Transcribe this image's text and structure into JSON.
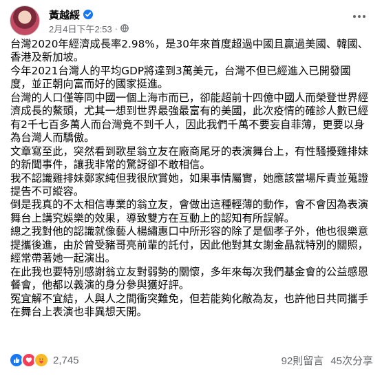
{
  "post": {
    "author": "黃越綏",
    "timestamp": "2月4日下午2:53",
    "separator": "·",
    "paragraphs": [
      "台灣2020年經濟成長率2.98%，是30年來首度超過中國且贏過美國、韓國、香港及新加坡。",
      "今年2021台灣人的平均GDP將達到3萬美元，台灣不但已經進入已開發國度，並正朝向富而好的國家挺進。",
      "台灣的人口僅等同中國一個上海市而已，卻能超前十四億中國人而榮登世界經濟成長的鰲頭，尤其一想到世界最強最富有的美國，此次疫情的確診人數已經有2千七百多萬人而台灣竟不到千人，因此我們千萬不要妄自菲薄，更要以身為台灣人而驕傲。",
      "文章寫至此，突然看到歌星翁立友在廠商尾牙的表演舞台上，有性騷擾雞排妹的新聞事件，讓我非常的驚訝卻不敢相信。",
      "我不認識雞排妹鄭家純但我很欣賞她，如果事情屬實，她應該當場斥責並蒐證提告不可縱容。",
      "倒是我真的不太相信專業的翁立友，會做出這種輕薄的動作，會不會因為表演舞台上講究娛樂的效果，導致雙方在互動上的認知有所誤解。",
      "總之我對他的認識就像藝人楊繡惠口中所形容的除了是個孝子外，他也很樂意提攜後進，由於曾受豬哥亮前輩的託付，因此他對其女謝金晶就特別的關照，經常帶著她一起演出。",
      "在此我也要特別感謝翁立友對弱勢的關懷，多年來每次我們基金會的公益感恩餐會，他都以義演的身分參與獲好評。",
      "冤宜解不宜結，人與人之間衝突難免，但若能夠化敵為友，也許他日共同攜手在舞台上表演也非異想天開。"
    ],
    "reaction_count": "2,745",
    "comments": "92則留言",
    "shares": "45次分享",
    "icons": [
      "verified-icon",
      "globe-icon",
      "more-icon",
      "like-icon",
      "love-icon",
      "care-icon"
    ],
    "colors": {
      "like": "#1877f2",
      "love": "#f33e58",
      "care": "#f7b928",
      "meta": "#65676b"
    }
  }
}
